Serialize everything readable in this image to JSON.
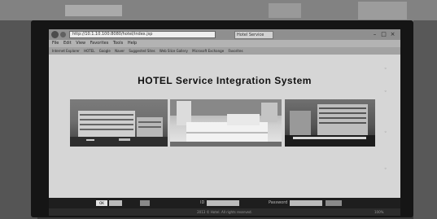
{
  "browser": {
    "address": "http://10.1.10.100:8080/hotel/index.jsp",
    "tab_title": "Hotel Service",
    "window_controls": [
      "–",
      "□",
      "×"
    ],
    "menu_items": [
      "File",
      "Edit",
      "View",
      "Favorites",
      "Tools",
      "Help"
    ],
    "favorites": [
      "Internet Explorer",
      "HOTEL",
      "Google",
      "Naver",
      "Suggested Sites",
      "Web Slice Gallery",
      "Microsoft Exchange",
      "Favorites"
    ]
  },
  "page": {
    "title": "HOTEL Service Integration System",
    "photos": [
      "hotel-exterior-photo",
      "guest-room-photo",
      "hotel-night-view-photo"
    ]
  },
  "login": {
    "button_label": "OK",
    "id_label": "ID",
    "password_label": "Password"
  },
  "footer": {
    "copyright": "2013 © Hotel. All rights reserved.",
    "zoom": "100%"
  },
  "colors": {
    "bezel": "#151515",
    "page_background": "#d6d6d6",
    "login_bar": "#1e1e1e"
  }
}
